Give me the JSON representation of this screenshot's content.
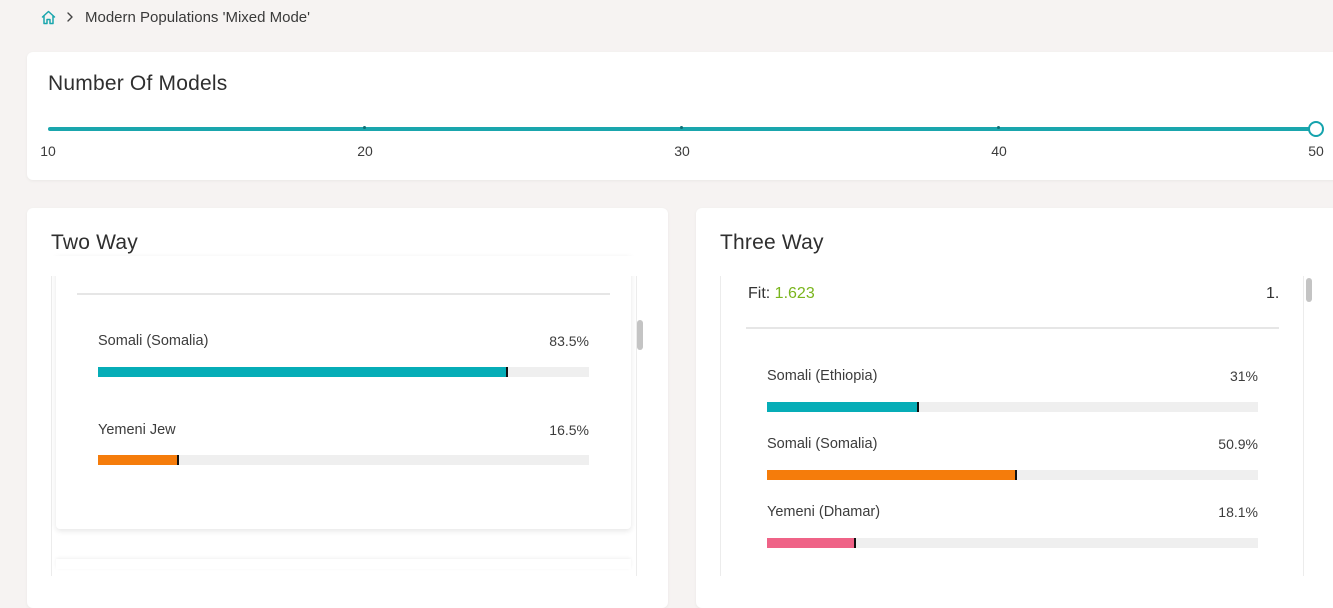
{
  "breadcrumb": {
    "current": "Modern Populations 'Mixed Mode'"
  },
  "models": {
    "title": "Number Of Models",
    "ticks": [
      "10",
      "20",
      "30",
      "40",
      "50"
    ],
    "min": 10,
    "max": 50,
    "value": 50
  },
  "two_way": {
    "title": "Two Way",
    "rows": [
      {
        "name": "Somali (Somalia)",
        "pct_label": "83.5%",
        "value": 83.5,
        "color": "#06adb7"
      },
      {
        "name": "Yemeni Jew",
        "pct_label": "16.5%",
        "value": 16.5,
        "color": "#f57c0b"
      }
    ]
  },
  "three_way": {
    "title": "Three Way",
    "fit_label": "Fit:",
    "fit_value": "1.623",
    "rank": "1.",
    "rows": [
      {
        "name": "Somali (Ethiopia)",
        "pct_label": "31%",
        "value": 31,
        "color": "#06adb7"
      },
      {
        "name": "Somali (Somalia)",
        "pct_label": "50.9%",
        "value": 50.9,
        "color": "#f57c0b"
      },
      {
        "name": "Yemeni (Dhamar)",
        "pct_label": "18.1%",
        "value": 18.1,
        "color": "#ef6387"
      }
    ]
  },
  "colors": {
    "accent": "#1aa6ad",
    "fit_green": "#7ab51d"
  }
}
